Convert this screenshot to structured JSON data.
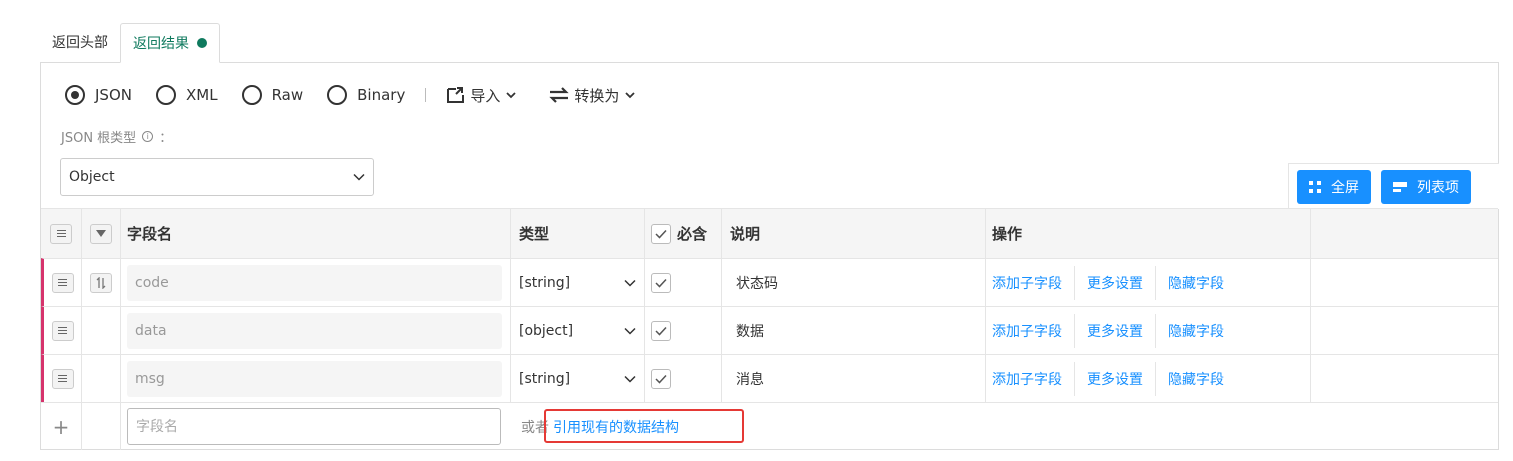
{
  "tabs": [
    {
      "label": "返回头部",
      "active": false
    },
    {
      "label": "返回结果",
      "active": true
    }
  ],
  "colors": {
    "accent_green": "#0f7a5e",
    "link_blue": "#1890ff",
    "row_marker": "#d6336c",
    "highlight_red": "#e53935"
  },
  "format": {
    "options": [
      "JSON",
      "XML",
      "Raw",
      "Binary"
    ],
    "selected": "JSON",
    "import_label": "导入",
    "convert_label": "转换为"
  },
  "root_type": {
    "label": "JSON 根类型",
    "info_icon": "i",
    "colon": "：",
    "value": "Object"
  },
  "toolbar": {
    "fullscreen_label": "全屏",
    "list_label": "列表项"
  },
  "table": {
    "headers": {
      "name": "字段名",
      "type": "类型",
      "required": "必含",
      "description": "说明",
      "operations": "操作"
    },
    "rows": [
      {
        "name": "code",
        "type": "[string]",
        "required": true,
        "description": "状态码"
      },
      {
        "name": "data",
        "type": "[object]",
        "required": true,
        "description": "数据"
      },
      {
        "name": "msg",
        "type": "[string]",
        "required": true,
        "description": "消息"
      }
    ],
    "op_labels": {
      "add_child": "添加子字段",
      "more_settings": "更多设置",
      "hide_field": "隐藏字段"
    }
  },
  "add_row": {
    "plus": "+",
    "placeholder": "字段名",
    "or_text": "或者",
    "reference_link": "引用现有的数据结构"
  }
}
